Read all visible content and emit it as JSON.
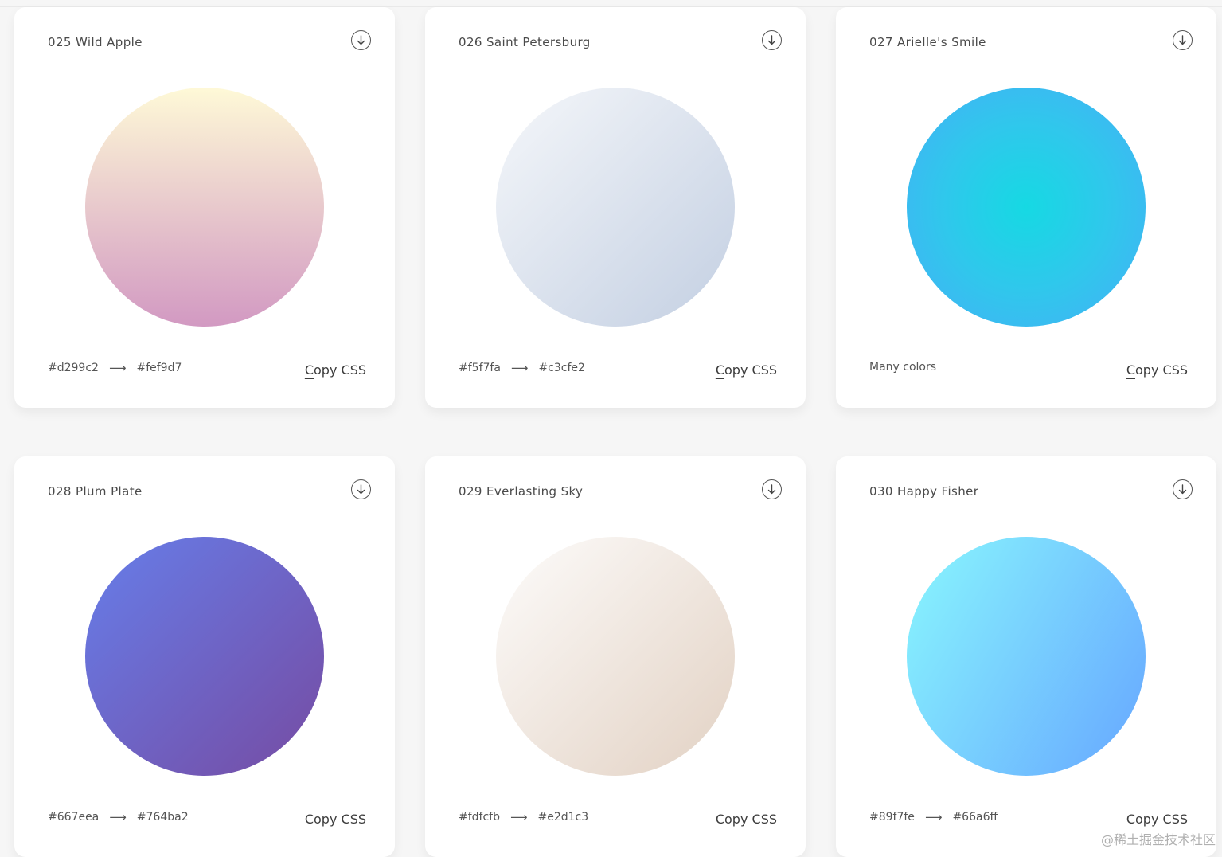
{
  "arrow_glyph": "⟶",
  "cards": [
    {
      "title": "025 Wild Apple",
      "from": "#d299c2",
      "to": "#fef9d7",
      "colors_text": "",
      "gradient_kind": "linear",
      "gradient_angle": "0deg",
      "gradient_stops": [
        "#d299c2",
        "#fef9d7"
      ],
      "copy_label": "Copy CSS"
    },
    {
      "title": "026 Saint Petersburg",
      "from": "#f5f7fa",
      "to": "#c3cfe2",
      "colors_text": "",
      "gradient_kind": "linear",
      "gradient_angle": "135deg",
      "gradient_stops": [
        "#f5f7fa",
        "#c3cfe2"
      ],
      "copy_label": "Copy CSS"
    },
    {
      "title": "027 Arielle's Smile",
      "from": "",
      "to": "",
      "colors_text": "Many colors",
      "gradient_kind": "radial",
      "gradient_angle": "",
      "gradient_stops": [
        "#16d9e3",
        "#30c7ec",
        "#46aef7"
      ],
      "copy_label": "Copy CSS"
    },
    {
      "title": "028 Plum Plate",
      "from": "#667eea",
      "to": "#764ba2",
      "colors_text": "",
      "gradient_kind": "linear",
      "gradient_angle": "135deg",
      "gradient_stops": [
        "#667eea",
        "#764ba2"
      ],
      "copy_label": "Copy CSS"
    },
    {
      "title": "029 Everlasting Sky",
      "from": "#fdfcfb",
      "to": "#e2d1c3",
      "colors_text": "",
      "gradient_kind": "linear",
      "gradient_angle": "135deg",
      "gradient_stops": [
        "#fdfcfb",
        "#e2d1c3"
      ],
      "copy_label": "Copy CSS"
    },
    {
      "title": "030 Happy Fisher",
      "from": "#89f7fe",
      "to": "#66a6ff",
      "colors_text": "",
      "gradient_kind": "linear",
      "gradient_angle": "120deg",
      "gradient_stops": [
        "#89f7fe",
        "#66a6ff"
      ],
      "copy_label": "Copy CSS"
    }
  ],
  "watermark": "@稀土掘金技术社区"
}
